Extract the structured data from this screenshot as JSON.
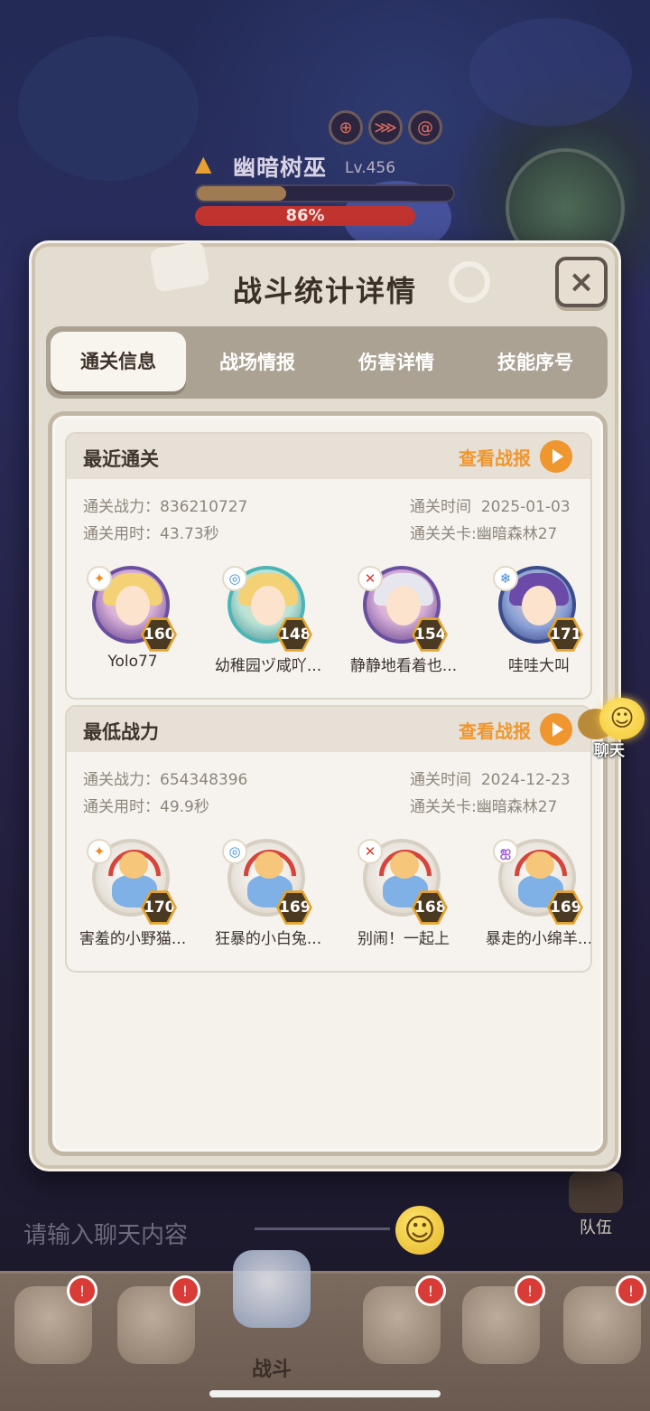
{
  "boss": {
    "name": "幽暗树巫",
    "level": "Lv.456",
    "hp_percent_text": "86%",
    "hp_fraction": 0.86,
    "status_icons": [
      "target-icon",
      "claw-icon",
      "swirl-icon"
    ]
  },
  "modal": {
    "title": "战斗统计详情",
    "close_label": "×",
    "tabs": [
      {
        "label": "通关信息",
        "active": true
      },
      {
        "label": "战场情报",
        "active": false
      },
      {
        "label": "伤害详情",
        "active": false
      },
      {
        "label": "技能序号",
        "active": false
      }
    ],
    "records": [
      {
        "title": "最近通关",
        "report_label": "查看战报",
        "power_label": "通关战力：",
        "power_value": "836210727",
        "duration_label": "通关用时：",
        "duration_value": "43.73秒",
        "time_label": "通关时间",
        "time_value": "2025-01-03",
        "stage_label": "通关关卡:",
        "stage_value": "幽暗森林27",
        "heroes": [
          {
            "name": "Yolo77",
            "level": "160",
            "element": "fire-icon"
          },
          {
            "name": "幼稚园ヅ咸吖...",
            "level": "148",
            "element": "water-icon"
          },
          {
            "name": "静静地看着也...",
            "level": "154",
            "element": "sword-icon"
          },
          {
            "name": "哇哇大叫",
            "level": "171",
            "element": "frost-icon"
          }
        ]
      },
      {
        "title": "最低战力",
        "report_label": "查看战报",
        "power_label": "通关战力：",
        "power_value": "654348396",
        "duration_label": "通关用时：",
        "duration_value": "49.9秒",
        "time_label": "通关时间",
        "time_value": "2024-12-23",
        "stage_label": "通关关卡:",
        "stage_value": "幽暗森林27",
        "heroes": [
          {
            "name": "害羞的小野猫...",
            "level": "170",
            "element": "fire-icon"
          },
          {
            "name": "狂暴的小白兔...",
            "level": "169",
            "element": "water-icon"
          },
          {
            "name": "别闹！一起上",
            "level": "168",
            "element": "sword-icon"
          },
          {
            "name": "暴走的小绵羊...",
            "level": "169",
            "element": "wind-icon"
          }
        ]
      }
    ]
  },
  "chat": {
    "bubble_label": "聊天",
    "input_placeholder": "请输入聊天内容"
  },
  "team": {
    "label": "队伍"
  },
  "bottom_nav": {
    "battle_label": "战斗"
  },
  "colors": {
    "accent_orange": "#f0962e",
    "panel_bg": "#e3ddd1",
    "level_badge": "#e4a32c",
    "notify_red": "#d93b36"
  }
}
